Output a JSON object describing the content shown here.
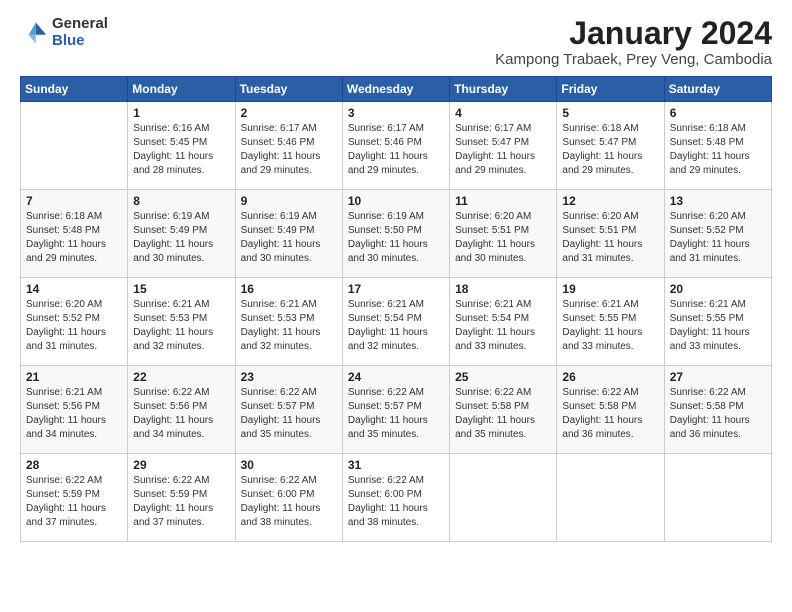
{
  "logo": {
    "general": "General",
    "blue": "Blue"
  },
  "title": "January 2024",
  "location": "Kampong Trabaek, Prey Veng, Cambodia",
  "days_header": [
    "Sunday",
    "Monday",
    "Tuesday",
    "Wednesday",
    "Thursday",
    "Friday",
    "Saturday"
  ],
  "weeks": [
    [
      {
        "day": "",
        "sunrise": "",
        "sunset": "",
        "daylight": ""
      },
      {
        "day": "1",
        "sunrise": "6:16 AM",
        "sunset": "5:45 PM",
        "daylight": "11 hours and 28 minutes."
      },
      {
        "day": "2",
        "sunrise": "6:17 AM",
        "sunset": "5:46 PM",
        "daylight": "11 hours and 29 minutes."
      },
      {
        "day": "3",
        "sunrise": "6:17 AM",
        "sunset": "5:46 PM",
        "daylight": "11 hours and 29 minutes."
      },
      {
        "day": "4",
        "sunrise": "6:17 AM",
        "sunset": "5:47 PM",
        "daylight": "11 hours and 29 minutes."
      },
      {
        "day": "5",
        "sunrise": "6:18 AM",
        "sunset": "5:47 PM",
        "daylight": "11 hours and 29 minutes."
      },
      {
        "day": "6",
        "sunrise": "6:18 AM",
        "sunset": "5:48 PM",
        "daylight": "11 hours and 29 minutes."
      }
    ],
    [
      {
        "day": "7",
        "sunrise": "6:18 AM",
        "sunset": "5:48 PM",
        "daylight": "11 hours and 29 minutes."
      },
      {
        "day": "8",
        "sunrise": "6:19 AM",
        "sunset": "5:49 PM",
        "daylight": "11 hours and 30 minutes."
      },
      {
        "day": "9",
        "sunrise": "6:19 AM",
        "sunset": "5:49 PM",
        "daylight": "11 hours and 30 minutes."
      },
      {
        "day": "10",
        "sunrise": "6:19 AM",
        "sunset": "5:50 PM",
        "daylight": "11 hours and 30 minutes."
      },
      {
        "day": "11",
        "sunrise": "6:20 AM",
        "sunset": "5:51 PM",
        "daylight": "11 hours and 30 minutes."
      },
      {
        "day": "12",
        "sunrise": "6:20 AM",
        "sunset": "5:51 PM",
        "daylight": "11 hours and 31 minutes."
      },
      {
        "day": "13",
        "sunrise": "6:20 AM",
        "sunset": "5:52 PM",
        "daylight": "11 hours and 31 minutes."
      }
    ],
    [
      {
        "day": "14",
        "sunrise": "6:20 AM",
        "sunset": "5:52 PM",
        "daylight": "11 hours and 31 minutes."
      },
      {
        "day": "15",
        "sunrise": "6:21 AM",
        "sunset": "5:53 PM",
        "daylight": "11 hours and 32 minutes."
      },
      {
        "day": "16",
        "sunrise": "6:21 AM",
        "sunset": "5:53 PM",
        "daylight": "11 hours and 32 minutes."
      },
      {
        "day": "17",
        "sunrise": "6:21 AM",
        "sunset": "5:54 PM",
        "daylight": "11 hours and 32 minutes."
      },
      {
        "day": "18",
        "sunrise": "6:21 AM",
        "sunset": "5:54 PM",
        "daylight": "11 hours and 33 minutes."
      },
      {
        "day": "19",
        "sunrise": "6:21 AM",
        "sunset": "5:55 PM",
        "daylight": "11 hours and 33 minutes."
      },
      {
        "day": "20",
        "sunrise": "6:21 AM",
        "sunset": "5:55 PM",
        "daylight": "11 hours and 33 minutes."
      }
    ],
    [
      {
        "day": "21",
        "sunrise": "6:21 AM",
        "sunset": "5:56 PM",
        "daylight": "11 hours and 34 minutes."
      },
      {
        "day": "22",
        "sunrise": "6:22 AM",
        "sunset": "5:56 PM",
        "daylight": "11 hours and 34 minutes."
      },
      {
        "day": "23",
        "sunrise": "6:22 AM",
        "sunset": "5:57 PM",
        "daylight": "11 hours and 35 minutes."
      },
      {
        "day": "24",
        "sunrise": "6:22 AM",
        "sunset": "5:57 PM",
        "daylight": "11 hours and 35 minutes."
      },
      {
        "day": "25",
        "sunrise": "6:22 AM",
        "sunset": "5:58 PM",
        "daylight": "11 hours and 35 minutes."
      },
      {
        "day": "26",
        "sunrise": "6:22 AM",
        "sunset": "5:58 PM",
        "daylight": "11 hours and 36 minutes."
      },
      {
        "day": "27",
        "sunrise": "6:22 AM",
        "sunset": "5:58 PM",
        "daylight": "11 hours and 36 minutes."
      }
    ],
    [
      {
        "day": "28",
        "sunrise": "6:22 AM",
        "sunset": "5:59 PM",
        "daylight": "11 hours and 37 minutes."
      },
      {
        "day": "29",
        "sunrise": "6:22 AM",
        "sunset": "5:59 PM",
        "daylight": "11 hours and 37 minutes."
      },
      {
        "day": "30",
        "sunrise": "6:22 AM",
        "sunset": "6:00 PM",
        "daylight": "11 hours and 38 minutes."
      },
      {
        "day": "31",
        "sunrise": "6:22 AM",
        "sunset": "6:00 PM",
        "daylight": "11 hours and 38 minutes."
      },
      {
        "day": "",
        "sunrise": "",
        "sunset": "",
        "daylight": ""
      },
      {
        "day": "",
        "sunrise": "",
        "sunset": "",
        "daylight": ""
      },
      {
        "day": "",
        "sunrise": "",
        "sunset": "",
        "daylight": ""
      }
    ]
  ]
}
